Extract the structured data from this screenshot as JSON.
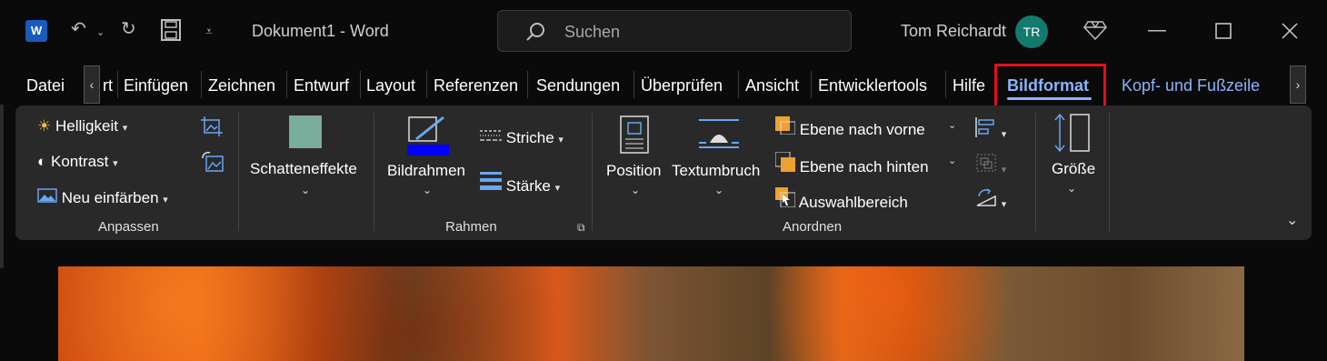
{
  "window": {
    "title": "Dokument1  -  Word",
    "search_placeholder": "Suchen",
    "user_name": "Tom Reichardt",
    "user_initials": "TR"
  },
  "tabs": [
    "Datei",
    "rt",
    "Einfügen",
    "Zeichnen",
    "Entwurf",
    "Layout",
    "Referenzen",
    "Sendungen",
    "Überprüfen",
    "Ansicht",
    "Entwicklertools",
    "Hilfe",
    "Bildformat",
    "Kopf- und Fußzeile"
  ],
  "ribbon": {
    "anpassen": {
      "helligkeit": "Helligkeit",
      "kontrast": "Kontrast",
      "neu_einfaerben": "Neu einfärben",
      "label": "Anpassen"
    },
    "schatteneffekte": "Schatteneffekte",
    "rahmen": {
      "bildrahmen": "Bildrahmen",
      "striche": "Striche",
      "staerke": "Stärke",
      "label": "Rahmen"
    },
    "anordnen": {
      "position": "Position",
      "textumbruch": "Textumbruch",
      "ebene_vorne": "Ebene nach vorne",
      "ebene_hinten": "Ebene nach hinten",
      "auswahlbereich": "Auswahlbereich",
      "label": "Anordnen"
    },
    "groesse": "Größe"
  },
  "colors": {
    "accent": "#8ab4f8",
    "highlight_box": "#e0101a",
    "avatar": "#157a6e",
    "bildrahmen_color": "#0000ff"
  }
}
